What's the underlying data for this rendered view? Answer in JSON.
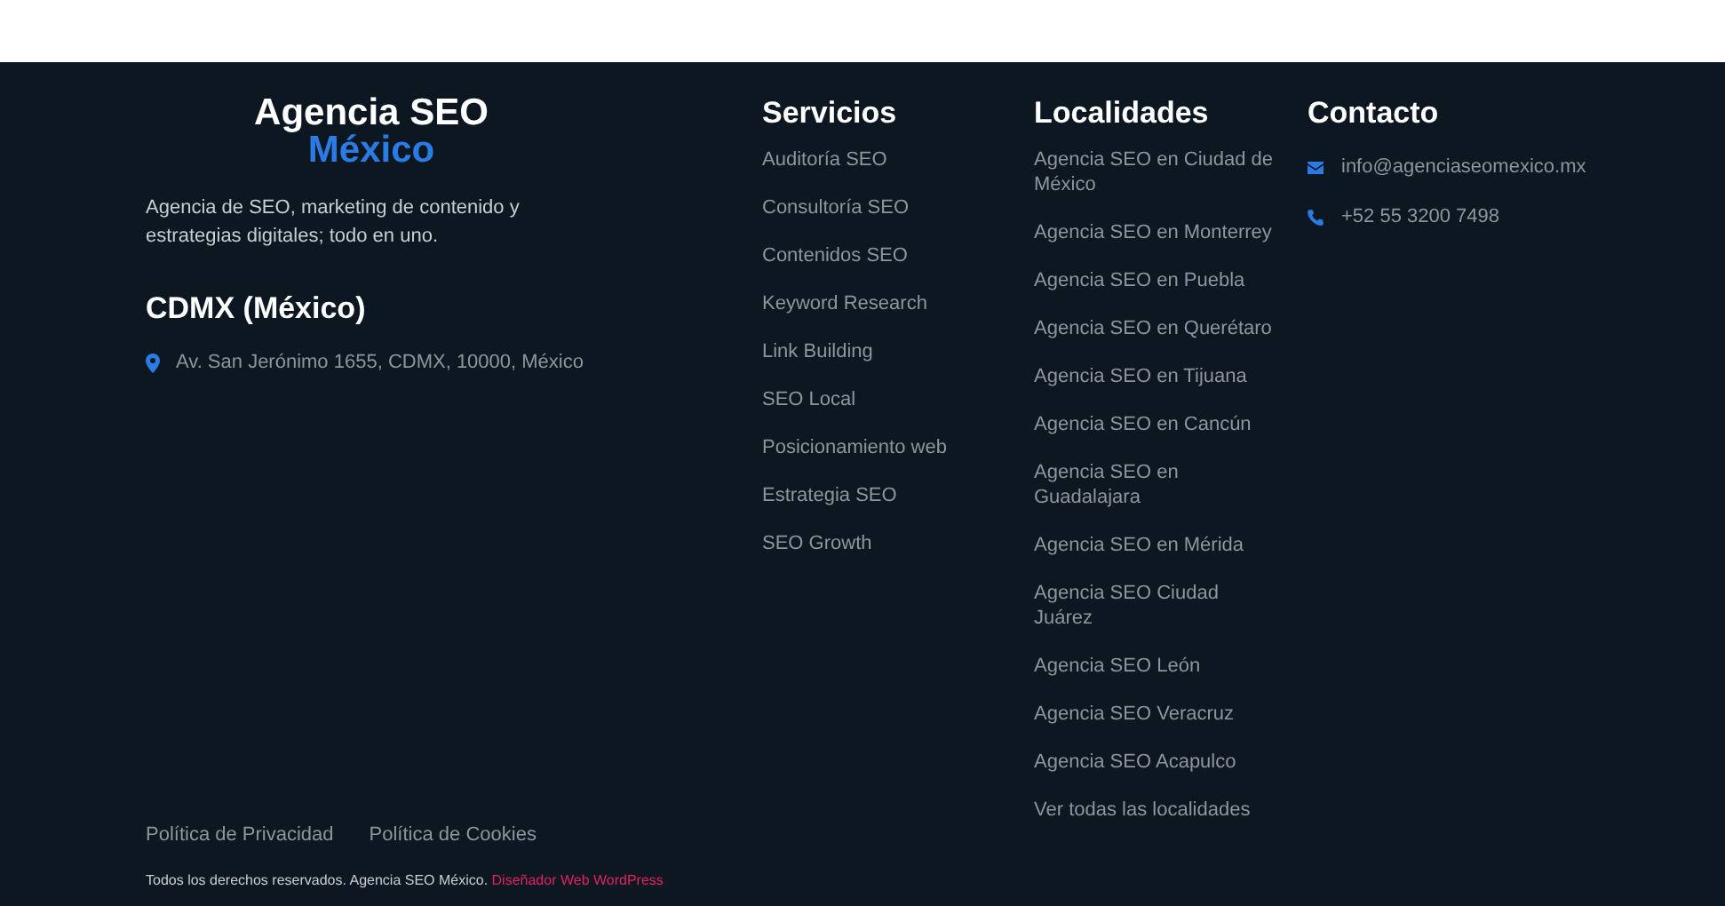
{
  "brand": {
    "line_1": "Agencia SEO",
    "line_2": "México"
  },
  "tagline": "Agencia de SEO, marketing de contenido y estrategias digitales; todo en uno.",
  "office": {
    "title": "CDMX (México)",
    "address": "Av. San Jerónimo 1655, CDMX, 10000, México"
  },
  "services": {
    "title": "Servicios",
    "items": [
      "Auditoría SEO",
      "Consultoría SEO",
      "Contenidos SEO",
      "Keyword Research",
      "Link Building",
      "SEO Local",
      "Posicionamiento web",
      "Estrategia SEO",
      "SEO Growth"
    ]
  },
  "locations": {
    "title": "Localidades",
    "items": [
      "Agencia SEO en Ciudad de México",
      "Agencia SEO en Monterrey",
      "Agencia SEO en Puebla",
      "Agencia SEO en Querétaro",
      "Agencia SEO en Tijuana",
      "Agencia SEO en Cancún",
      "Agencia SEO en Guadalajara",
      "Agencia SEO en Mérida",
      "Agencia SEO Ciudad Juárez",
      "Agencia SEO León",
      "Agencia SEO Veracruz",
      "Agencia SEO Acapulco",
      "Ver todas las localidades"
    ]
  },
  "contact": {
    "title": "Contacto",
    "items": [
      {
        "kind": "email",
        "text": "info@agenciaseomexico.mx"
      },
      {
        "kind": "phone",
        "text": "+52 55 3200 7498"
      }
    ]
  },
  "legal_links": [
    "Política de Privacidad",
    "Política de Cookies"
  ],
  "copyright": {
    "text": "Todos los derechos reservados. Agencia SEO México.",
    "link": "Diseñador Web WordPress"
  }
}
